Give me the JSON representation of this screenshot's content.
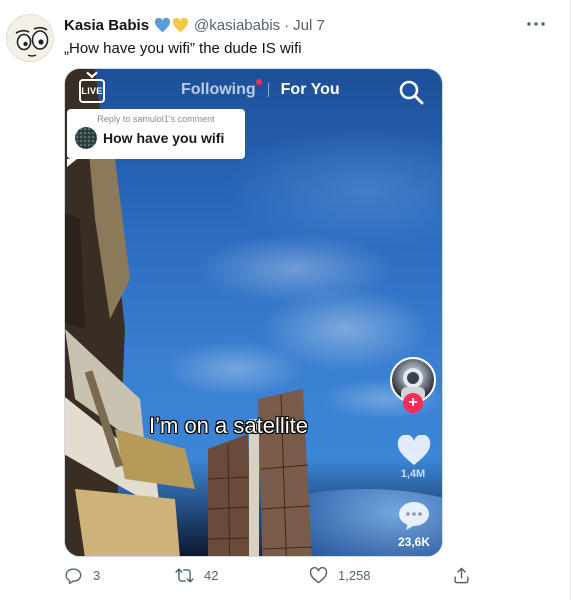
{
  "tweet": {
    "author_name": "Kasia Babis",
    "handle": "@kasiababis",
    "separator": "·",
    "date": "Jul 7",
    "text": "„How have you wifi” the dude IS wifi",
    "more_icon": "more-horizontal-icon"
  },
  "media": {
    "live_label": "LIVE",
    "tabs": {
      "following": "Following",
      "for_you": "For You"
    },
    "reply": {
      "header": "Reply to samulol1's comment",
      "text": "How have you wifi"
    },
    "caption": "I’m on a satellite",
    "likes_count": "1,4M",
    "comments_count": "23,6K",
    "accent_color": "#fe2c55"
  },
  "actions": {
    "replies": "3",
    "retweets": "42",
    "likes": "1,258"
  },
  "colors": {
    "muted": "#536471",
    "heart_blue": "#5b9bd5",
    "heart_yellow": "#f4c842"
  }
}
